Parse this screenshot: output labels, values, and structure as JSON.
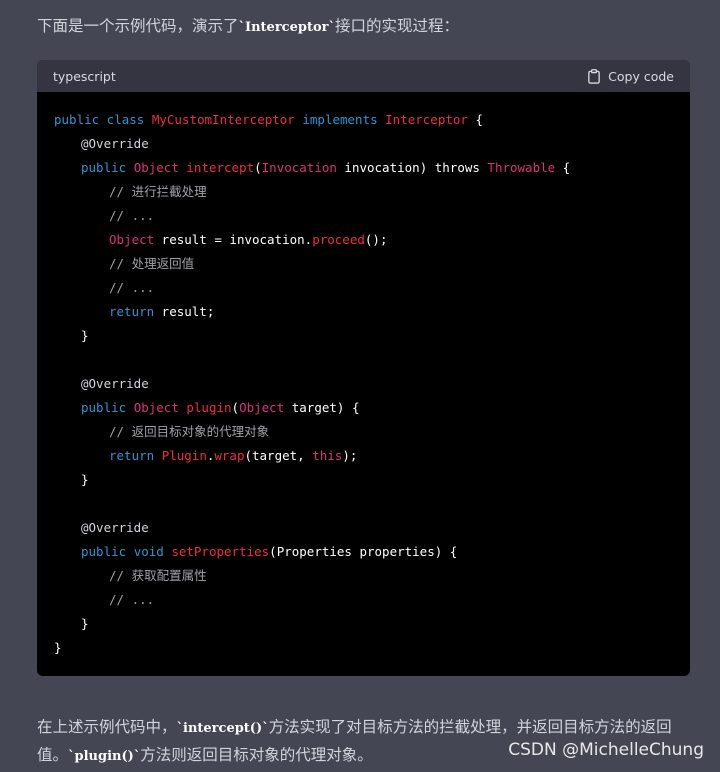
{
  "intro": {
    "text_before": "下面是一个示例代码，演示了",
    "code": "`Interceptor`",
    "text_after": "接口的实现过程："
  },
  "codeblock": {
    "language": "typescript",
    "copy_label": "Copy code",
    "copy_icon": "clipboard-icon",
    "colors": {
      "keyword": "#2e95d3",
      "type": "#df3079",
      "function": "#f22c3d",
      "comment": "#a0a1a7"
    }
  },
  "code": {
    "l1": {
      "a": "public class ",
      "b": "MyCustomInterceptor",
      "c": " implements ",
      "d": "Interceptor",
      "e": " {"
    },
    "l2": "@Override",
    "l3": {
      "a": "public ",
      "b": "Object",
      "c": " ",
      "d": "intercept",
      "e": "(",
      "f": "Invocation",
      "g": " invocation) throws ",
      "h": "Throwable",
      "i": " {"
    },
    "l4": "// 进行拦截处理",
    "l5": "// ...",
    "l6": {
      "a": "Object",
      "b": " result = invocation.",
      "c": "proceed",
      "d": "();"
    },
    "l7": "// 处理返回值",
    "l8": "// ...",
    "l9": {
      "a": "return",
      "b": " result;"
    },
    "l10": "}",
    "l12": "@Override",
    "l13": {
      "a": "public ",
      "b": "Object",
      "c": " ",
      "d": "plugin",
      "e": "(",
      "f": "Object",
      "g": " target) {"
    },
    "l14": "// 返回目标对象的代理对象",
    "l15": {
      "a": "return ",
      "b": "Plugin",
      "c": ".",
      "d": "wrap",
      "e": "(target, ",
      "f": "this",
      "g": ");"
    },
    "l16": "}",
    "l18": "@Override",
    "l19": {
      "a": "public ",
      "b": "void",
      "c": " ",
      "d": "setProperties",
      "e": "(Properties properties) {"
    },
    "l20": "// 获取配置属性",
    "l21": "// ...",
    "l22": "}",
    "l23": "}"
  },
  "outro": {
    "p1": "在上述示例代码中，",
    "c1": "`intercept()`",
    "p2": "方法实现了对目标方法的拦截处理，并返回目标方法的返回值。",
    "c2": "`plugin()`",
    "p3": "方法则返回目标对象的代理对象。"
  },
  "watermark": "CSDN @MichelleChung"
}
